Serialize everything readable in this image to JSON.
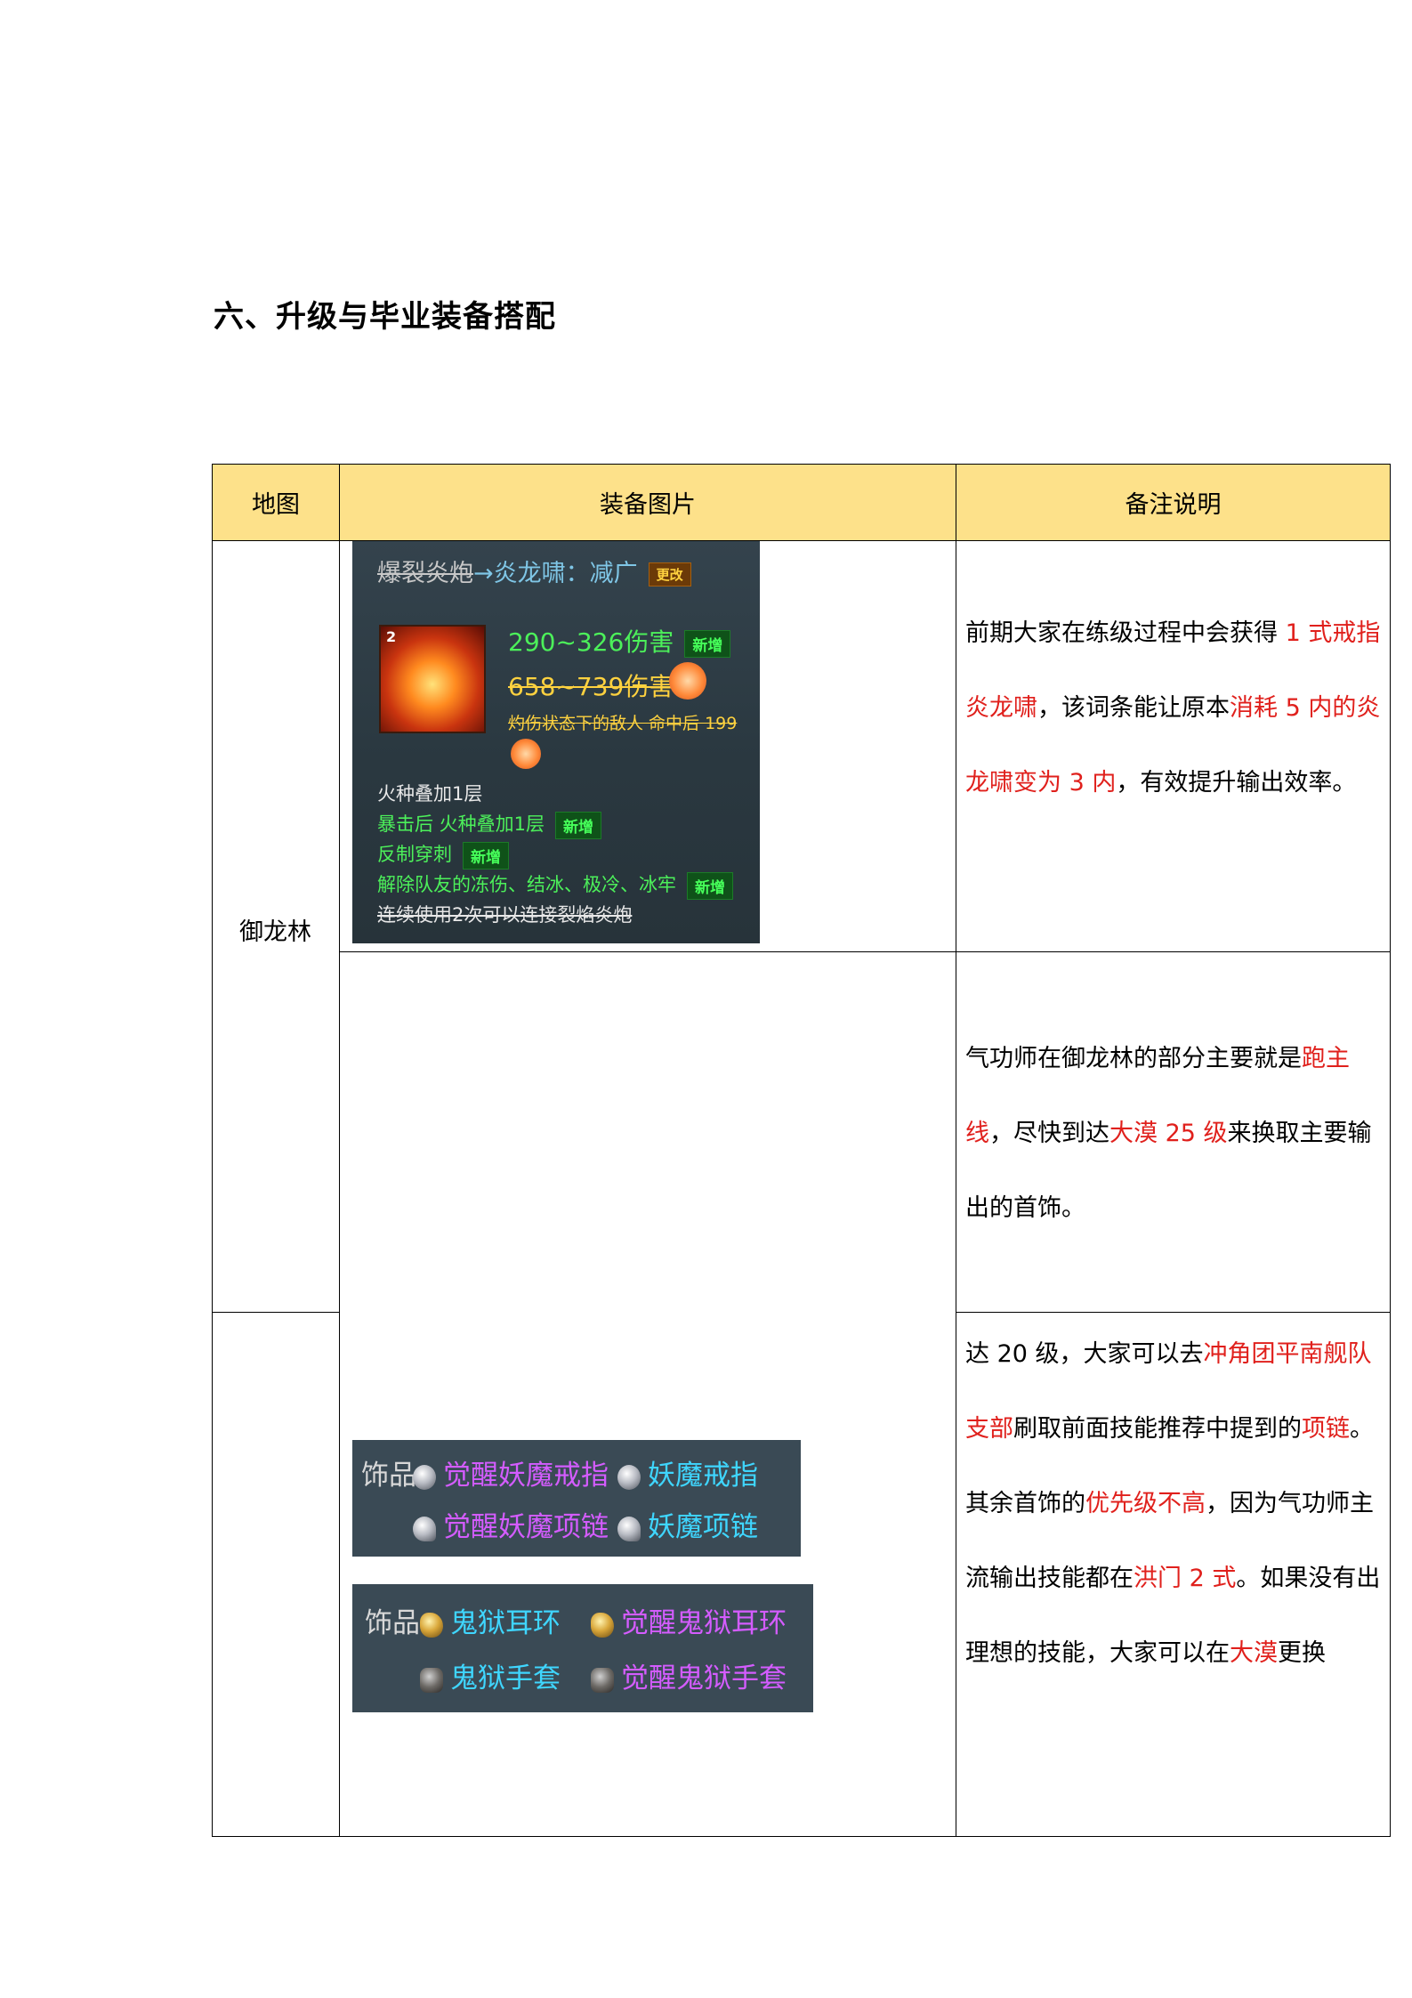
{
  "heading": "六、升级与毕业装备搭配",
  "table": {
    "headers": {
      "map": "地图",
      "equipment_image": "装备图片",
      "notes": "备注说明"
    },
    "map_name": "御龙林",
    "rows": [
      {
        "notes": [
          [
            {
              "t": "前期大家在练级过程中会获得 ",
              "c": "normal"
            },
            {
              "t": "1 式戒指炎龙啸",
              "c": "red"
            },
            {
              "t": "，该词条能让原本",
              "c": "normal"
            },
            {
              "t": "消耗 5 内的炎龙啸变为 3 内",
              "c": "red"
            },
            {
              "t": "，有效提升输出效率。",
              "c": "normal"
            }
          ]
        ]
      },
      {
        "notes": [
          [
            {
              "t": "气功师在御龙林的部分主要就是",
              "c": "normal"
            },
            {
              "t": "跑主线",
              "c": "red"
            },
            {
              "t": "，尽快到达",
              "c": "normal"
            },
            {
              "t": "大漠 25 级",
              "c": "red"
            },
            {
              "t": "来换取主要输出的首饰。",
              "c": "normal"
            }
          ]
        ]
      },
      {
        "notes": [
          [
            {
              "t": "达 20 级，大家可以去",
              "c": "normal"
            },
            {
              "t": "冲角团平南舰队支部",
              "c": "red"
            },
            {
              "t": "刷取前面技能推荐中提到的",
              "c": "normal"
            },
            {
              "t": "项链",
              "c": "red"
            },
            {
              "t": "。",
              "c": "normal"
            }
          ],
          [
            {
              "t": "其余首饰的",
              "c": "normal"
            },
            {
              "t": "优先级不高",
              "c": "red"
            },
            {
              "t": "，因为气功师主流输出技能都在",
              "c": "normal"
            },
            {
              "t": "洪门 2 式",
              "c": "red"
            },
            {
              "t": "。如果没有出理想的技能，大家可以在",
              "c": "normal"
            },
            {
              "t": "大漠",
              "c": "red"
            },
            {
              "t": "更换",
              "c": "normal"
            }
          ]
        ]
      }
    ]
  },
  "skill_tooltip": {
    "old_skill": "爆裂炎炮",
    "arrow": "→",
    "new_skill": "炎龙啸：减广",
    "change_tag": "更改",
    "icon_level": "2",
    "damage_new": "290~326伤害",
    "damage_old": "658~739伤害",
    "new_tag": "新增",
    "burn_text": "灼伤状态下的敌人 命中后 199",
    "effects": [
      {
        "text": "火种叠加1层",
        "tag": "",
        "style": "white"
      },
      {
        "text": "暴击后 火种叠加1层",
        "tag": "新增",
        "style": "green"
      },
      {
        "text": "反制穿刺",
        "tag": "新增",
        "style": "green"
      },
      {
        "text": "解除队友的冻伤、结冰、极冷、冰牢",
        "tag": "新增",
        "style": "green"
      },
      {
        "text": "连续使用2次可以连接裂焰炎炮",
        "tag": "",
        "style": "strike"
      }
    ]
  },
  "accessories_1": {
    "label": "饰品",
    "items": [
      {
        "name": "觉醒妖魔戒指",
        "color": "purple",
        "icon": "ring-icon"
      },
      {
        "name": "妖魔戒指",
        "color": "cyan",
        "icon": "ring-icon"
      },
      {
        "name": "觉醒妖魔项链",
        "color": "purple",
        "icon": "necklace-icon"
      },
      {
        "name": "妖魔项链",
        "color": "cyan",
        "icon": "necklace-icon"
      }
    ]
  },
  "accessories_2": {
    "label": "饰品",
    "items": [
      {
        "name": "鬼狱耳环",
        "color": "cyan",
        "icon": "earring-icon"
      },
      {
        "name": "觉醒鬼狱耳环",
        "color": "purple",
        "icon": "earring-icon"
      },
      {
        "name": "鬼狱手套",
        "color": "cyan",
        "icon": "glove-icon"
      },
      {
        "name": "觉醒鬼狱手套",
        "color": "purple",
        "icon": "glove-icon"
      }
    ]
  },
  "colors": {
    "header_bg": "#fde18a",
    "red_text": "#e0201c",
    "green_text": "#4cf05a",
    "purple_text": "#d45cff",
    "cyan_text": "#3fd6ff"
  }
}
